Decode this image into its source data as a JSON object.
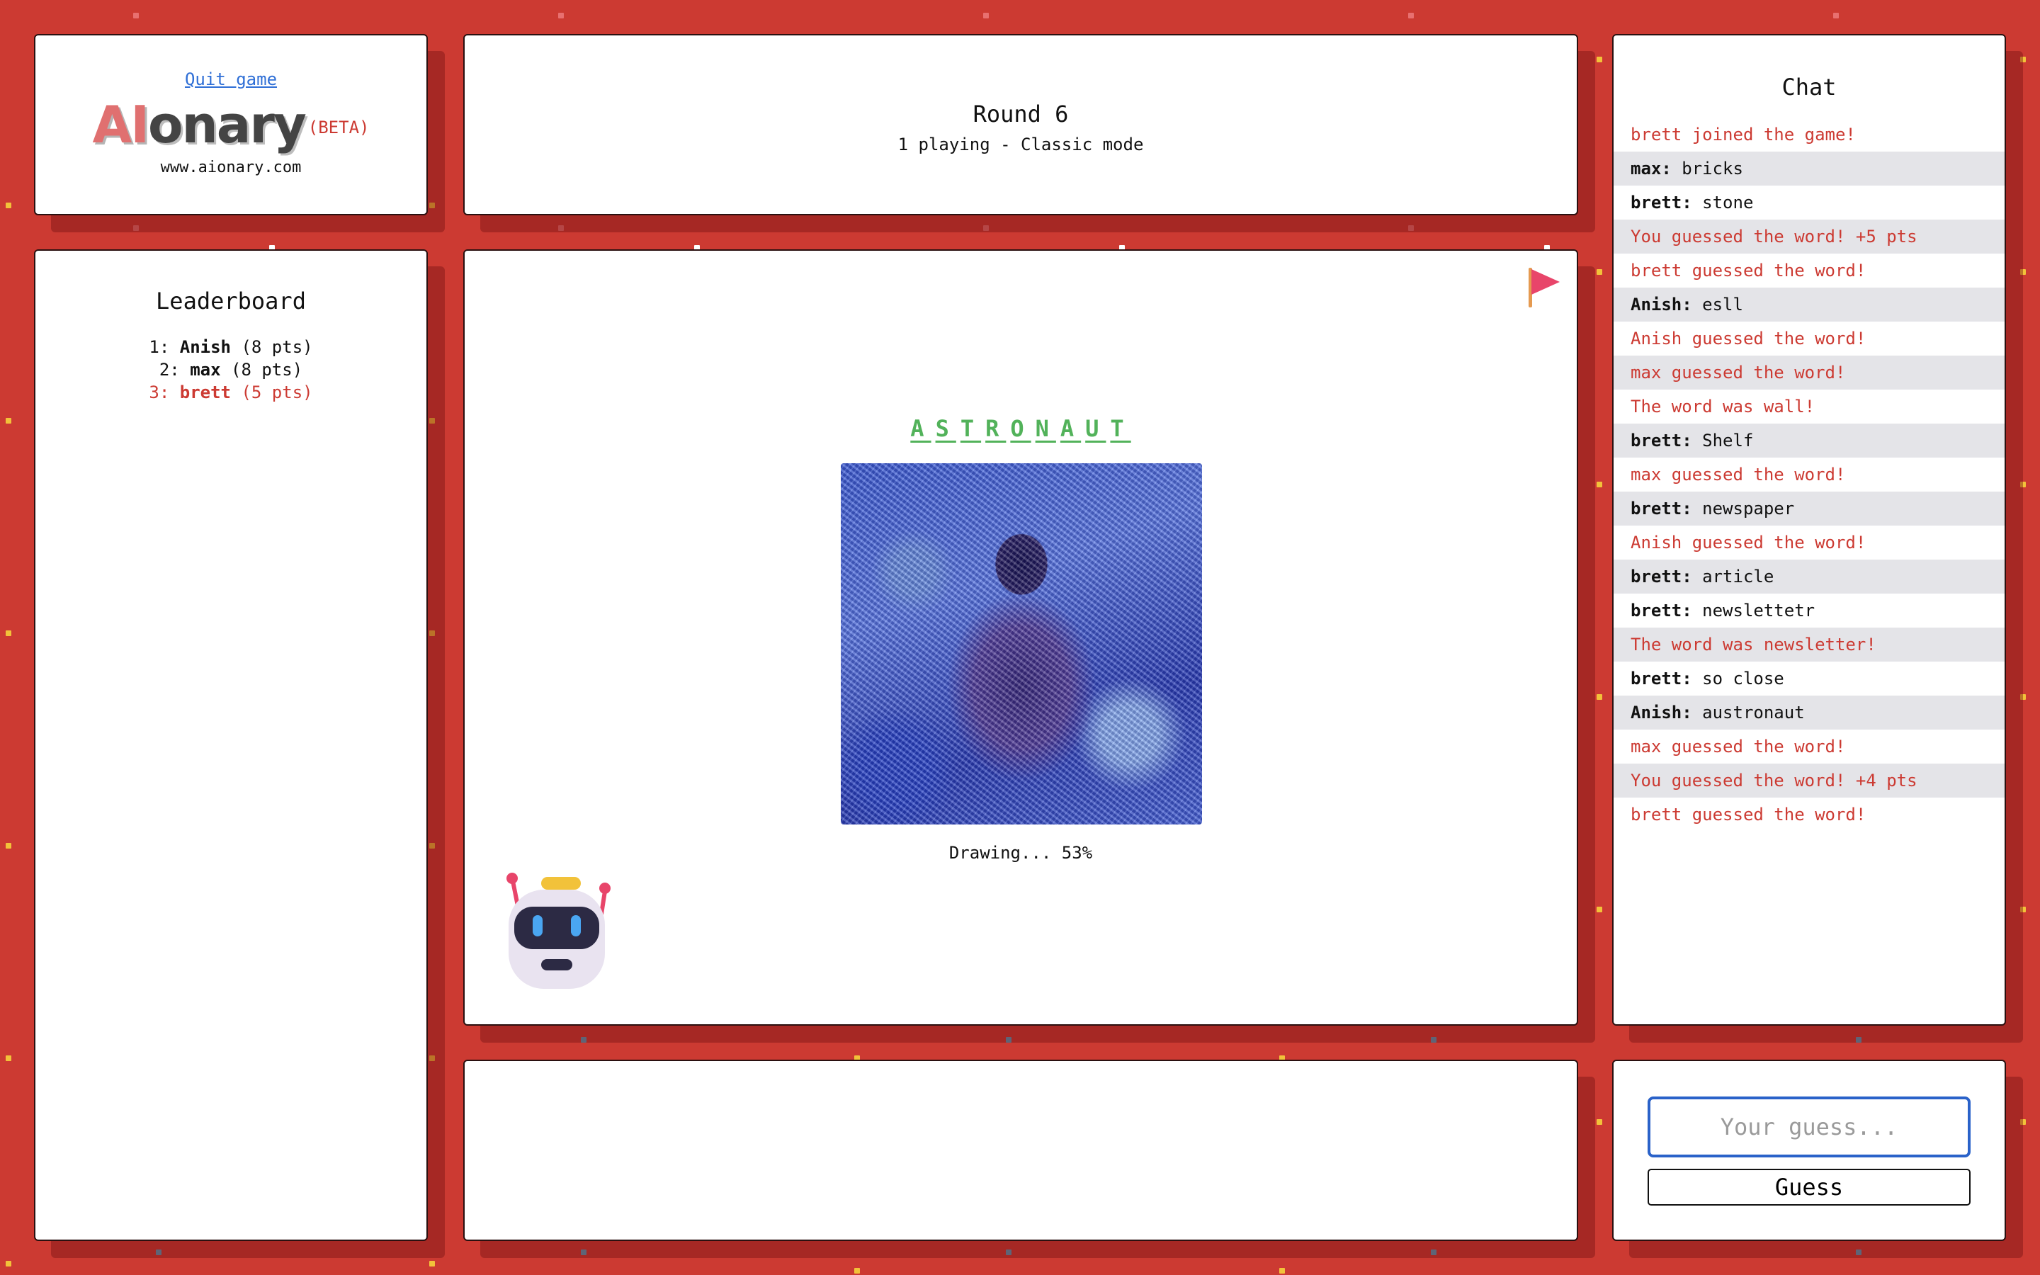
{
  "header": {
    "quit_label": "Quit game",
    "logo_ai": "AI",
    "logo_rest": "onary",
    "beta": "(BETA)",
    "site": "www.aionary.com"
  },
  "round": {
    "title": "Round 6",
    "subtitle": "1 playing - Classic mode"
  },
  "chat": {
    "title": "Chat",
    "messages": [
      {
        "text": "brett joined the game!"
      },
      {
        "user": "max:",
        "text": "bricks"
      },
      {
        "user": "brett:",
        "text": "stone"
      },
      {
        "text": "You guessed the word! +5 pts"
      },
      {
        "text": "brett guessed the word!"
      },
      {
        "user": "Anish:",
        "text": "esll"
      },
      {
        "text": "Anish guessed the word!"
      },
      {
        "text": "max guessed the word!"
      },
      {
        "text": "The word was wall!"
      },
      {
        "user": "brett:",
        "text": "Shelf"
      },
      {
        "text": "max guessed the word!"
      },
      {
        "user": "brett:",
        "text": "newspaper"
      },
      {
        "text": "Anish guessed the word!"
      },
      {
        "user": "brett:",
        "text": "article"
      },
      {
        "user": "brett:",
        "text": "newslettetr"
      },
      {
        "text": "The word was newsletter!"
      },
      {
        "user": "brett:",
        "text": "so close"
      },
      {
        "user": "Anish:",
        "text": "austronaut"
      },
      {
        "text": "max guessed the word!"
      },
      {
        "text": "You guessed the word! +4 pts"
      },
      {
        "text": "brett guessed the word!"
      }
    ]
  },
  "leaderboard": {
    "title": "Leaderboard",
    "entries": [
      {
        "rank": "1:",
        "name": "Anish",
        "pts": "(8 pts)",
        "me": false
      },
      {
        "rank": "2:",
        "name": "max",
        "pts": "(8 pts)",
        "me": false
      },
      {
        "rank": "3:",
        "name": "brett",
        "pts": "(5 pts)",
        "me": true
      }
    ]
  },
  "canvas": {
    "word_letters": [
      "A",
      "S",
      "T",
      "R",
      "O",
      "N",
      "A",
      "U",
      "T"
    ],
    "status": "Drawing... 53%",
    "progress": 0.53
  },
  "guess": {
    "placeholder": "Your guess...",
    "button_label": "Guess"
  },
  "colors": {
    "background": "#cc3a32",
    "accent": "#cc3a32",
    "word": "#52b25a",
    "input_border": "#2a62c9",
    "chat_alt_row": "#e4e4e8"
  },
  "icons": [
    "flag-icon",
    "robot-icon"
  ]
}
